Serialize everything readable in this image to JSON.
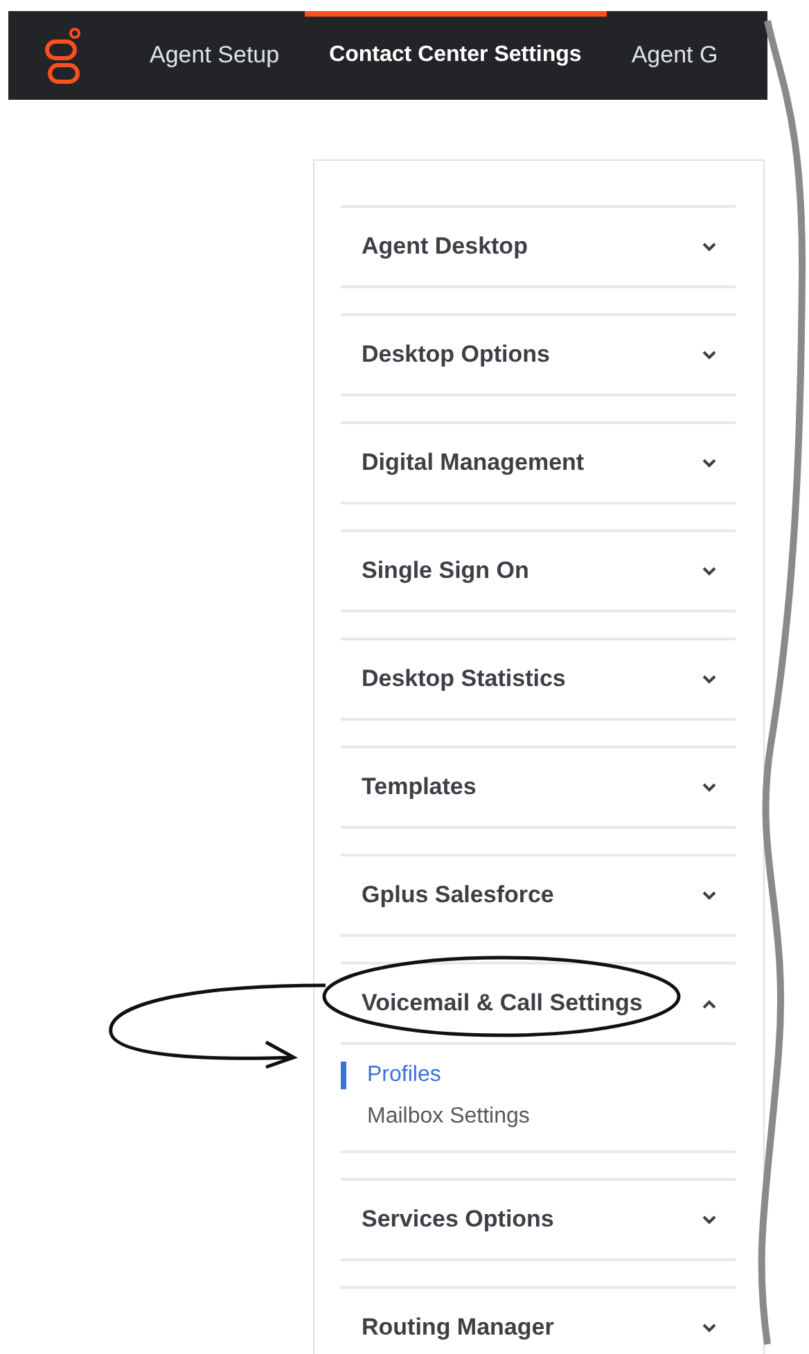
{
  "nav": {
    "tabs": [
      {
        "label": "Agent Setup",
        "selected": false
      },
      {
        "label": "Contact Center Settings",
        "selected": true
      },
      {
        "label": "Agent G",
        "selected": false
      }
    ]
  },
  "accordion": [
    {
      "title": "Agent Desktop",
      "expanded": false
    },
    {
      "title": "Desktop Options",
      "expanded": false
    },
    {
      "title": "Digital Management",
      "expanded": false
    },
    {
      "title": "Single Sign On",
      "expanded": false
    },
    {
      "title": "Desktop Statistics",
      "expanded": false
    },
    {
      "title": "Templates",
      "expanded": false
    },
    {
      "title": "Gplus Salesforce",
      "expanded": false
    },
    {
      "title": "Voicemail & Call Settings",
      "expanded": true,
      "children": [
        {
          "label": "Profiles",
          "selected": true
        },
        {
          "label": "Mailbox Settings",
          "selected": false
        }
      ]
    },
    {
      "title": "Services Options",
      "expanded": false
    },
    {
      "title": "Routing Manager",
      "expanded": false
    }
  ]
}
